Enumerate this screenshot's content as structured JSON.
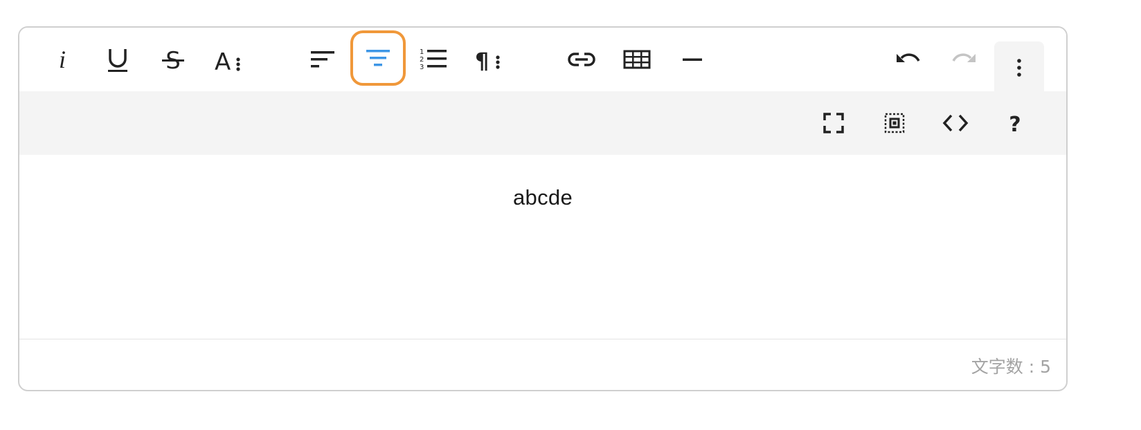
{
  "toolbar": {
    "buttons": [
      {
        "name": "italic-button",
        "icon": "italic-icon"
      },
      {
        "name": "underline-button",
        "icon": "underline-icon"
      },
      {
        "name": "strikethrough-button",
        "icon": "strikethrough-icon"
      },
      {
        "name": "font-format-button",
        "icon": "font-format-icon"
      },
      {
        "name": "align-left-button",
        "icon": "align-left-icon"
      },
      {
        "name": "align-center-button",
        "icon": "align-center-icon",
        "active": true
      },
      {
        "name": "ordered-list-button",
        "icon": "ordered-list-icon"
      },
      {
        "name": "paragraph-format-button",
        "icon": "paragraph-icon"
      },
      {
        "name": "link-button",
        "icon": "link-icon"
      },
      {
        "name": "table-button",
        "icon": "table-icon"
      },
      {
        "name": "horizontal-rule-button",
        "icon": "horizontal-rule-icon"
      },
      {
        "name": "undo-button",
        "icon": "undo-icon"
      },
      {
        "name": "redo-button",
        "icon": "redo-icon",
        "disabled": true
      },
      {
        "name": "more-button",
        "icon": "more-vertical-icon"
      }
    ],
    "more_buttons": [
      {
        "name": "fullscreen-button",
        "icon": "fullscreen-icon"
      },
      {
        "name": "select-all-button",
        "icon": "select-all-icon"
      },
      {
        "name": "code-view-button",
        "icon": "code-icon"
      },
      {
        "name": "help-button",
        "icon": "help-icon",
        "glyph": "?"
      }
    ]
  },
  "editor": {
    "content": "abcde"
  },
  "status": {
    "char_count": "文字数 : 5"
  },
  "colors": {
    "icon": "#222222",
    "icon_disabled": "#c4c4c4",
    "active_icon": "#3d96e6",
    "active_border": "#f0983a",
    "toolbar_gray": "#f4f4f4",
    "border": "#cfcfcf",
    "status_text": "#a3a3a3"
  }
}
